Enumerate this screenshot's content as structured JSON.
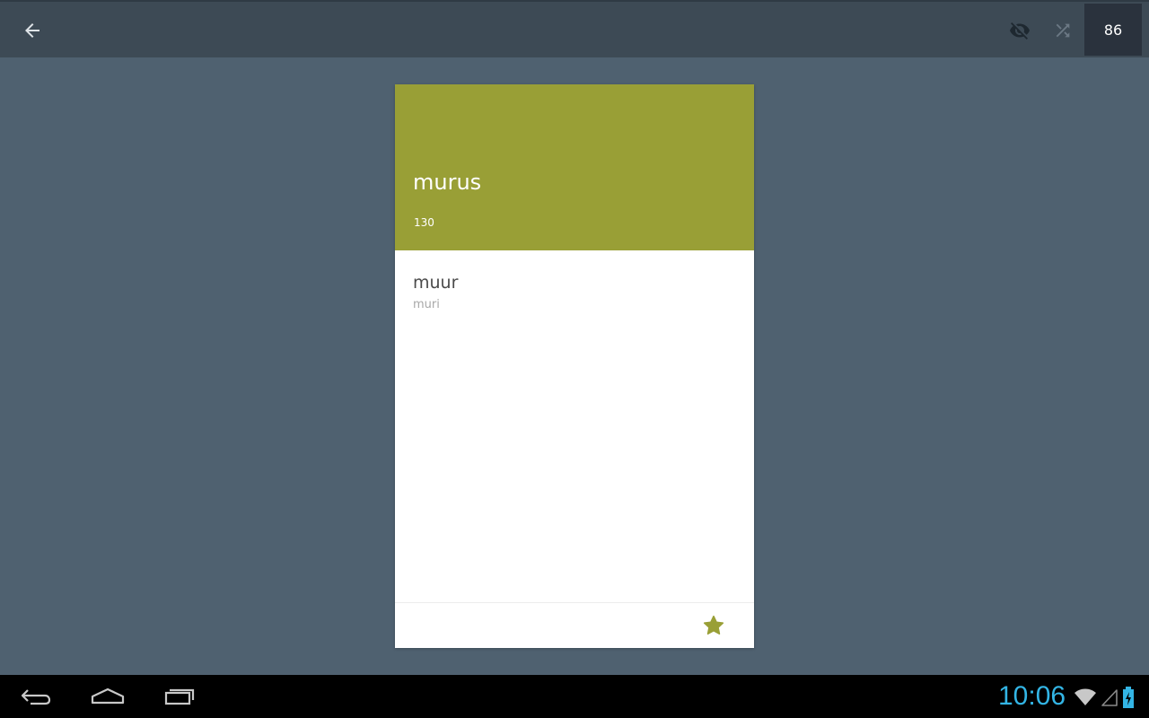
{
  "appbar": {
    "back_icon": "arrow-left-icon",
    "hide_icon": "eye-off-icon",
    "shuffle_icon": "shuffle-icon",
    "counter": "86"
  },
  "card": {
    "term": "murus",
    "number": "130",
    "translation": "muur",
    "translation_sub": "muri",
    "star_icon": "star-icon",
    "colors": {
      "header": "#999f36",
      "star": "#999f36"
    }
  },
  "system": {
    "time": "10:06",
    "nav_icons": [
      "back-icon",
      "home-icon",
      "recents-icon"
    ],
    "status_icons": [
      "wifi-icon",
      "signal-icon",
      "battery-charging-icon"
    ],
    "accent": "#33b5e5"
  }
}
